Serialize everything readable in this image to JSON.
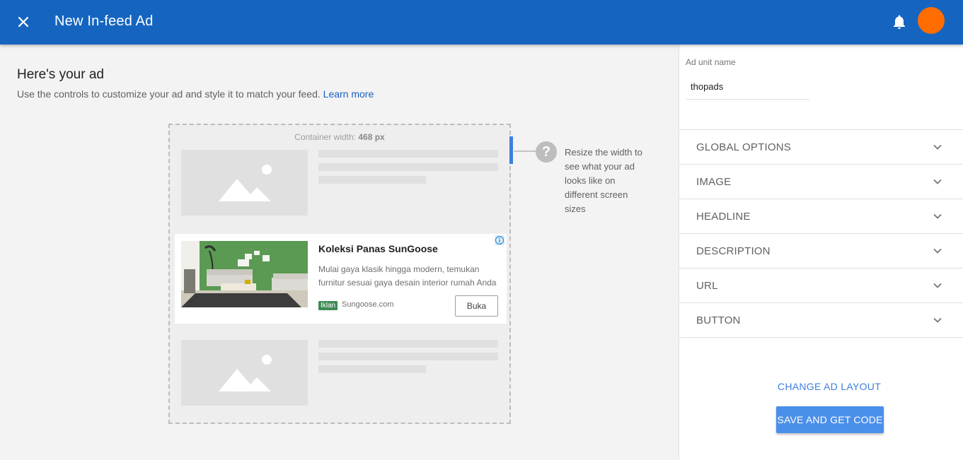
{
  "header": {
    "title": "New In-feed Ad",
    "close_icon": "close-icon",
    "notifications_icon": "bell-icon",
    "avatar_color": "#ff6d00",
    "bar_color": "#1565c0"
  },
  "main": {
    "heading": "Here's your ad",
    "subtitle": "Use the controls to customize your ad and style it to match your feed.",
    "learn_more": "Learn more",
    "container_width_label": "Container width:",
    "container_width_value": "468 px",
    "help_icon": "question-mark-icon",
    "help_text": "Resize the width to see what your ad looks like on different screen sizes"
  },
  "ad": {
    "headline": "Koleksi Panas SunGoose",
    "description": "Mulai gaya klasik hingga modern, temukan furnitur sesuai gaya desain interior rumah Anda",
    "badge": "Iklan",
    "url": "Sungoose.com",
    "button": "Buka",
    "adchoices_icon": "info-icon"
  },
  "sidebar": {
    "ad_unit_label": "Ad unit name",
    "ad_unit_value": "thopads",
    "sections": [
      {
        "label": "GLOBAL OPTIONS"
      },
      {
        "label": "IMAGE"
      },
      {
        "label": "HEADLINE"
      },
      {
        "label": "DESCRIPTION"
      },
      {
        "label": "URL"
      },
      {
        "label": "BUTTON"
      }
    ],
    "change_layout": "CHANGE AD LAYOUT",
    "save_button": "SAVE AND GET CODE"
  },
  "colors": {
    "accent": "#4a8fea",
    "link": "#1a5fc4",
    "badge": "#3d8b55"
  }
}
